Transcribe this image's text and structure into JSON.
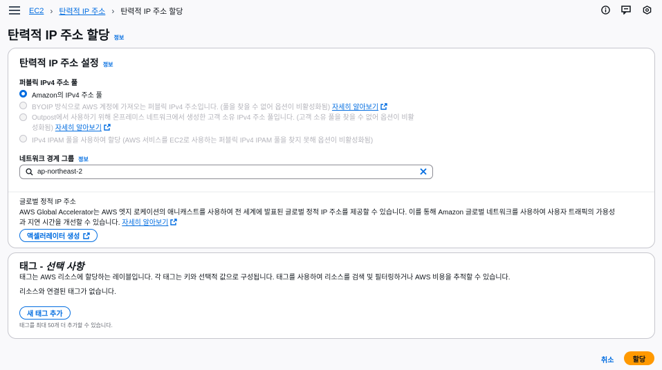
{
  "breadcrumb": {
    "items": [
      "EC2",
      "탄력적 IP 주소",
      "탄력적 IP 주소 할당"
    ]
  },
  "page": {
    "title": "탄력적 IP 주소 할당",
    "info": "정보"
  },
  "settings": {
    "title": "탄력적 IP 주소 설정",
    "info": "정보",
    "pool_label": "퍼블릭 IPv4 주소 풀",
    "options": [
      {
        "label": "Amazon의 IPv4 주소 풀",
        "selected": true,
        "disabled": false
      },
      {
        "label": "BYOIP 방식으로 AWS 계정에 가져오는 퍼블릭 IPv4 주소입니다. (풀을 찾을 수 없어 옵션이 비활성화됨)",
        "link": "자세히 알아보기",
        "selected": false,
        "disabled": true
      },
      {
        "label": "Outpost에서 사용하기 위해 온프레미스 네트워크에서 생성한 고객 소유 IPv4 주소 풀입니다. (고객 소유 풀을 찾을 수 없어 옵션이 비활",
        "label2": "성화됨)",
        "link": "자세히 알아보기",
        "selected": false,
        "disabled": true
      },
      {
        "label": "IPv4 IPAM 풀을 사용하여 할당 (AWS 서비스를 EC2로 사용하는 퍼블릭 IPv4 IPAM 풀을 찾지 못해 옵션이 비활성화됨)",
        "selected": false,
        "disabled": true
      }
    ],
    "nbg_label": "네트워크 경계 그룹",
    "nbg_info": "정보",
    "nbg_value": "ap-northeast-2",
    "global_label": "글로벌 정적 IP 주소",
    "global_desc1": "AWS Global Accelerator는 AWS 엣지 로케이션의 애니캐스트를 사용하여 전 세계에 발표된 글로벌 정적 IP 주소를 제공할 수 있습니다. 이를 통해 Amazon 글로벌 네트워크를 사용하여 사용자 트래픽의 가용성",
    "global_desc2": "과 지연 시간을 개선할 수 있습니다.",
    "global_link": "자세히 알아보기",
    "accelerator_button": "액셀러레이터 생성"
  },
  "tags": {
    "title_prefix": "태그 - ",
    "title_italic": "선택 사항",
    "desc": "태그는 AWS 리소스에 할당하는 레이블입니다. 각 태그는 키와 선택적 값으로 구성됩니다. 태그를 사용하여 리소스를 검색 및 필터링하거나 AWS 비용을 추적할 수 있습니다.",
    "empty": "리소스와 연결된 태그가 없습니다.",
    "add_button": "새 태그 추가",
    "limit": "태그를 최대 50개 더 추가할 수 있습니다."
  },
  "footer": {
    "cancel": "취소",
    "submit": "할당"
  },
  "colors": {
    "link": "#006ce0",
    "primary": "#ff9900"
  }
}
